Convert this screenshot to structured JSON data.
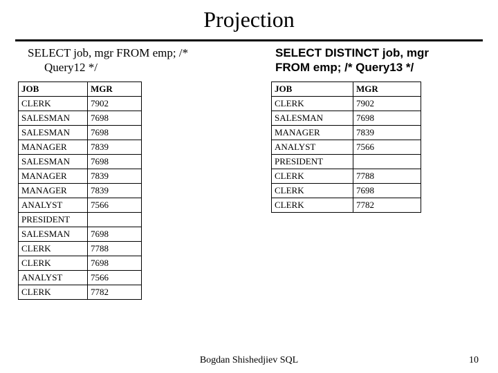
{
  "title": "Projection",
  "left_query": {
    "line1": "SELECT job, mgr FROM emp; /*",
    "line2": "Query12 */"
  },
  "right_query": {
    "line1": "SELECT DISTINCT job, mgr",
    "line2": "FROM emp; /* Query13 */"
  },
  "left_table": {
    "headers": [
      "JOB",
      "MGR"
    ],
    "rows": [
      [
        "CLERK",
        "7902"
      ],
      [
        "SALESMAN",
        "7698"
      ],
      [
        "SALESMAN",
        "7698"
      ],
      [
        "MANAGER",
        "7839"
      ],
      [
        "SALESMAN",
        "7698"
      ],
      [
        "MANAGER",
        "7839"
      ],
      [
        "MANAGER",
        "7839"
      ],
      [
        "ANALYST",
        "7566"
      ],
      [
        "PRESIDENT",
        ""
      ],
      [
        "SALESMAN",
        "7698"
      ],
      [
        "CLERK",
        "7788"
      ],
      [
        "CLERK",
        "7698"
      ],
      [
        "ANALYST",
        "7566"
      ],
      [
        "CLERK",
        "7782"
      ]
    ]
  },
  "right_table": {
    "headers": [
      "JOB",
      "MGR"
    ],
    "rows": [
      [
        "CLERK",
        "7902"
      ],
      [
        "SALESMAN",
        "7698"
      ],
      [
        "MANAGER",
        "7839"
      ],
      [
        "ANALYST",
        "7566"
      ],
      [
        "PRESIDENT",
        ""
      ],
      [
        "CLERK",
        "7788"
      ],
      [
        "CLERK",
        "7698"
      ],
      [
        "CLERK",
        "7782"
      ]
    ]
  },
  "footer": "Bogdan Shishedjiev SQL",
  "page_number": "10"
}
